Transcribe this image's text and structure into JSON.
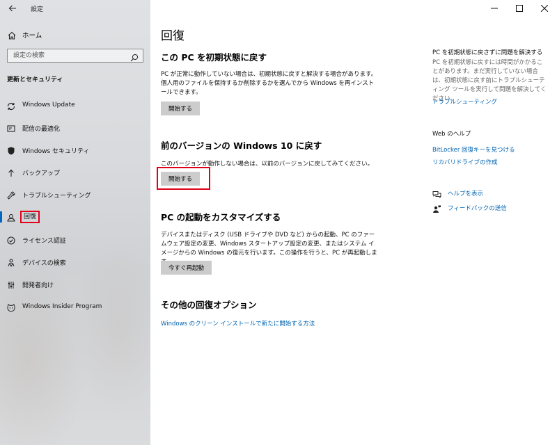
{
  "window": {
    "app_title": "設定",
    "back_icon": "back-arrow-icon",
    "controls": [
      "minimize-icon",
      "maximize-icon",
      "close-icon"
    ]
  },
  "sidebar": {
    "home_label": "ホーム",
    "search_placeholder": "設定の検索",
    "section_heading": "更新とセキュリティ",
    "items": [
      {
        "label": "Windows Update",
        "icon": "sync-icon"
      },
      {
        "label": "配信の最適化",
        "icon": "delivery-icon"
      },
      {
        "label": "Windows セキュリティ",
        "icon": "shield-icon"
      },
      {
        "label": "バックアップ",
        "icon": "backup-arrow-icon"
      },
      {
        "label": "トラブルシューティング",
        "icon": "wrench-icon"
      },
      {
        "label": "回復",
        "icon": "recovery-person-icon",
        "active": true
      },
      {
        "label": "ライセンス認証",
        "icon": "check-circle-icon"
      },
      {
        "label": "デバイスの検索",
        "icon": "person-location-icon"
      },
      {
        "label": "開発者向け",
        "icon": "developer-sliders-icon"
      },
      {
        "label": "Windows Insider Program",
        "icon": "insider-cat-icon"
      }
    ]
  },
  "main": {
    "title": "回復",
    "sections": [
      {
        "title": "この PC を初期状態に戻す",
        "text": "PC が正常に動作していない場合は、初期状態に戻すと解決する場合があります。個人用のファイルを保持するか削除するかを選んでから Windows を再インストールできます。",
        "button": "開始する"
      },
      {
        "title": "前のバージョンの Windows 10 に戻す",
        "text": "このバージョンが動作しない場合は、以前のバージョンに戻してみてください。",
        "button": "開始する"
      },
      {
        "title": "PC の起動をカスタマイズする",
        "text": "デバイスまたはディスク (USB ドライブや DVD など) からの起動、PC のファームウェア設定の変更、Windows スタートアップ設定の変更、またはシステム イメージからの Windows の復元を行います。この操作を行うと、PC が再起動します。",
        "button": "今すぐ再起動"
      },
      {
        "title": "その他の回復オプション",
        "link": "Windows のクリーン インストールで新たに開始する方法"
      }
    ]
  },
  "right": {
    "reset_heading": "PC を初期状態に戻さずに問題を解決する",
    "reset_text": "PC を初期状態に戻すには時間がかかることがあります。まだ実行していない場合は、初期状態に戻す前にトラブルシューティング ツールを実行して問題を解決してください。",
    "troubleshoot_link": "トラブルシューティング",
    "web_help_heading": "Web のヘルプ",
    "web_links": [
      "BitLocker 回復キーを見つける",
      "リカバリドライブの作成"
    ],
    "help_link": "ヘルプを表示",
    "feedback_link": "フィードバックの送信"
  }
}
